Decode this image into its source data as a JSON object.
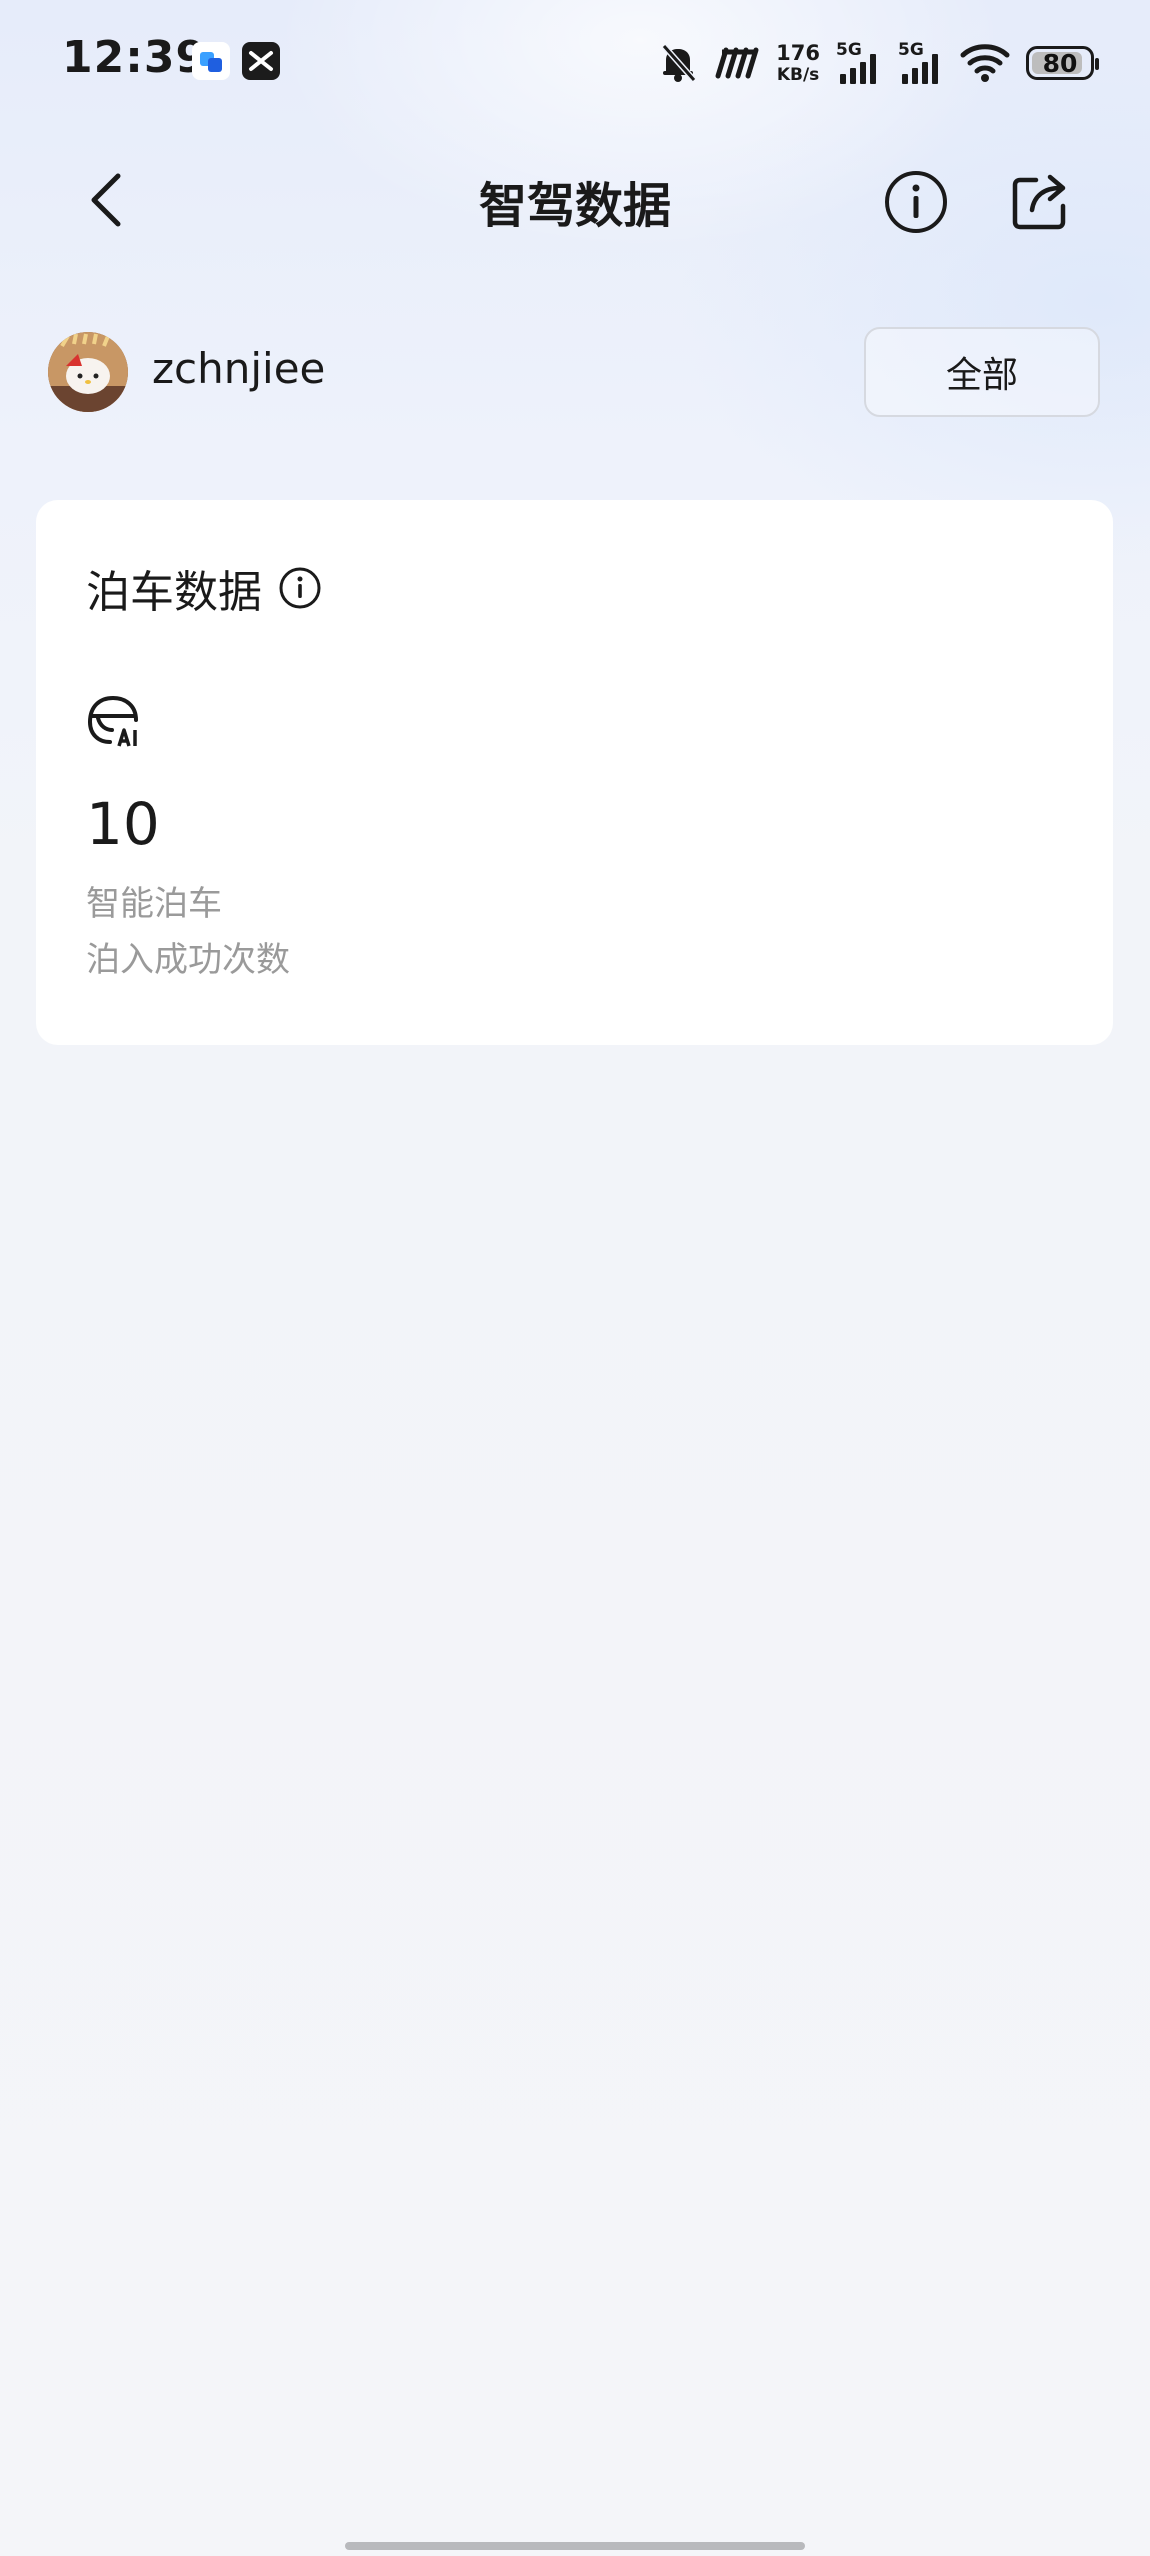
{
  "status_bar": {
    "time": "12:39",
    "net_speed_value": "176",
    "net_speed_unit": "KB/s",
    "signal_1_label": "5G",
    "signal_2_label": "5G",
    "battery_level": "80",
    "icons": [
      "app-notification-icon",
      "x-app-icon",
      "mute-bell-icon",
      "hd-icon",
      "signal-icon",
      "wifi-icon",
      "battery-icon"
    ]
  },
  "header": {
    "title": "智驾数据",
    "icons": [
      "back-arrow-icon",
      "info-icon",
      "share-icon"
    ]
  },
  "user": {
    "name": "zchnjiee",
    "filter_label": "全部"
  },
  "parking_card": {
    "title": "泊车数据",
    "icon": "ai-parking-icon",
    "value": "10",
    "label": "智能泊车",
    "sublabel": "泊入成功次数"
  },
  "colors": {
    "text_primary": "#1a1a1a",
    "text_secondary": "#9a9a9a",
    "card_bg": "#ffffff",
    "page_bg": "#f4f5f9"
  }
}
